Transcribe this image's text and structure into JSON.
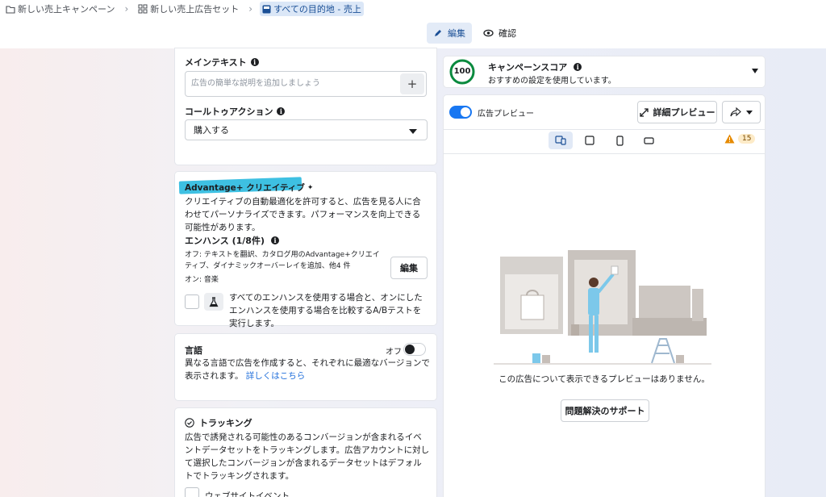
{
  "breadcrumb": {
    "campaign": "新しい売上キャンペーン",
    "adset": "新しい売上広告セット",
    "ad": "すべての目的地 - 売上"
  },
  "mode_tabs": {
    "edit": "編集",
    "review": "確認"
  },
  "main_text": {
    "label": "メインテキスト",
    "placeholder": "広告の簡単な説明を追加しましょう",
    "add": "+"
  },
  "cta": {
    "label": "コールトゥアクション",
    "value": "購入する"
  },
  "advantage": {
    "title": "Advantage+ クリエイティブ",
    "description": "クリエイティブの自動最適化を許可すると、広告を見る人に合わせてパーソナライズできます。パフォーマンスを向上できる可能性があります。",
    "enhance_label": "エンハンス (1/8件)",
    "off_text": "オフ: テキストを翻訳、カタログ用のAdvantage+クリエイティブ、ダイナミックオーバーレイを追加、他4 件",
    "on_text": "オン: 音楽",
    "edit_button": "編集",
    "ab_test_text": "すべてのエンハンスを使用する場合と、オンにしたエンハンスを使用する場合を比較するA/Bテストを実行します。"
  },
  "language": {
    "title": "言語",
    "toggle_label": "オフ",
    "description": "異なる言語で広告を作成すると、それぞれに最適なバージョンで表示されます。",
    "learn_more": "詳しくはこちら"
  },
  "tracking": {
    "title": "トラッキング",
    "description": "広告で誘発される可能性のあるコンバージョンが含まれるイベントデータセットをトラッキングします。広告アカウントに対して選択したコンバージョンが含まれるデータセットはデフォルトでトラッキングされます。",
    "website_events": "ウェブサイトイベント"
  },
  "campaign_score": {
    "score": "100",
    "title": "キャンペーンスコア",
    "subtitle": "おすすめの設定を使用しています。"
  },
  "preview": {
    "toggle_label": "広告プレビュー",
    "detail_button": "詳細プレビュー",
    "warning_count": "15",
    "empty_message": "この広告について表示できるプレビューはありません。",
    "support_button": "問題解決のサポート"
  },
  "colors": {
    "accent": "#1877f2",
    "score_green": "#0a8a3e",
    "highlight": "#3ec0e2",
    "warning": "#e68a00"
  }
}
